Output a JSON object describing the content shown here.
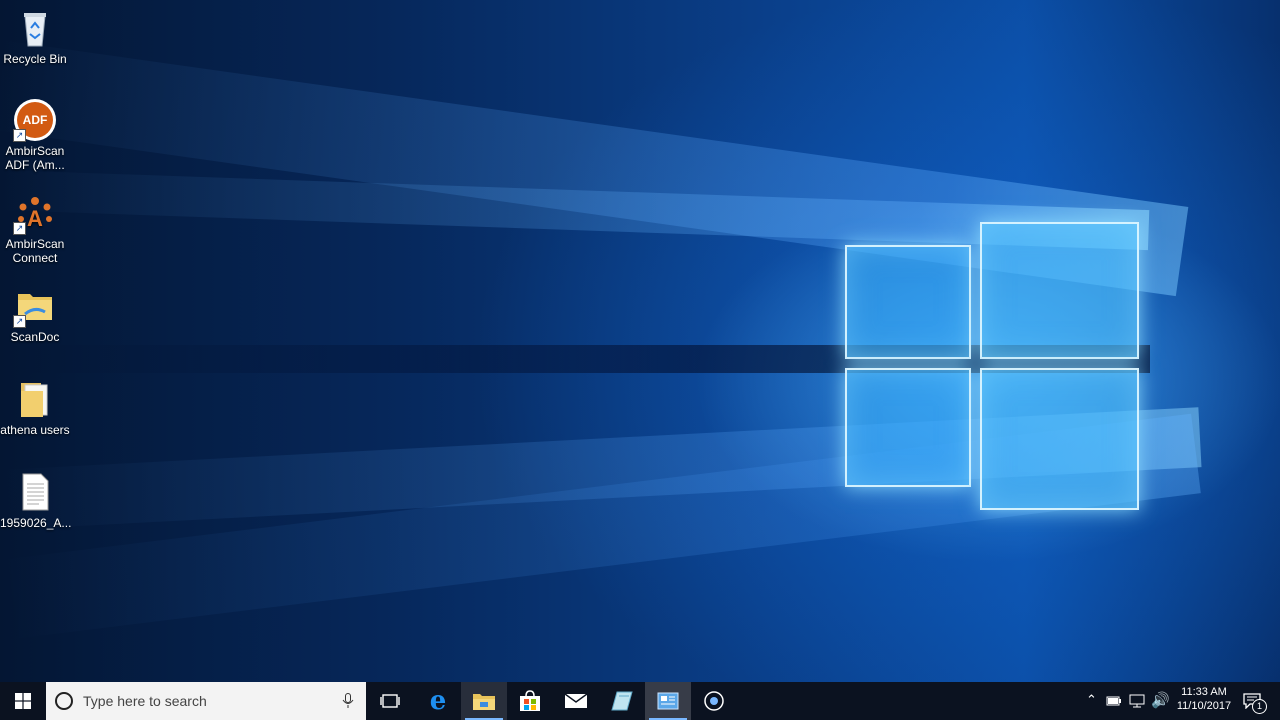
{
  "desktop": {
    "icons": [
      {
        "label": "Recycle Bin",
        "icon": "recycle-bin-icon"
      },
      {
        "label": "AmbirScan ADF (Am...",
        "icon": "ambirscan-adf-icon",
        "badge": "ADF"
      },
      {
        "label": "AmbirScan Connect",
        "icon": "ambirscan-connect-icon"
      },
      {
        "label": "ScanDoc",
        "icon": "folder-icon"
      },
      {
        "label": "athena users",
        "icon": "folder-icon"
      },
      {
        "label": "1959026_A...",
        "icon": "document-icon"
      }
    ]
  },
  "taskbar": {
    "search_placeholder": "Type here to search",
    "clock_time": "11:33 AM",
    "clock_date": "11/10/2017",
    "notification_count": "1",
    "pinned": [
      "task-view",
      "edge",
      "file-explorer",
      "store",
      "mail",
      "app",
      "control-panel",
      "cortana-circle"
    ]
  },
  "colors": {
    "taskbar": "#0b1220",
    "accent": "#7ab8ff"
  }
}
